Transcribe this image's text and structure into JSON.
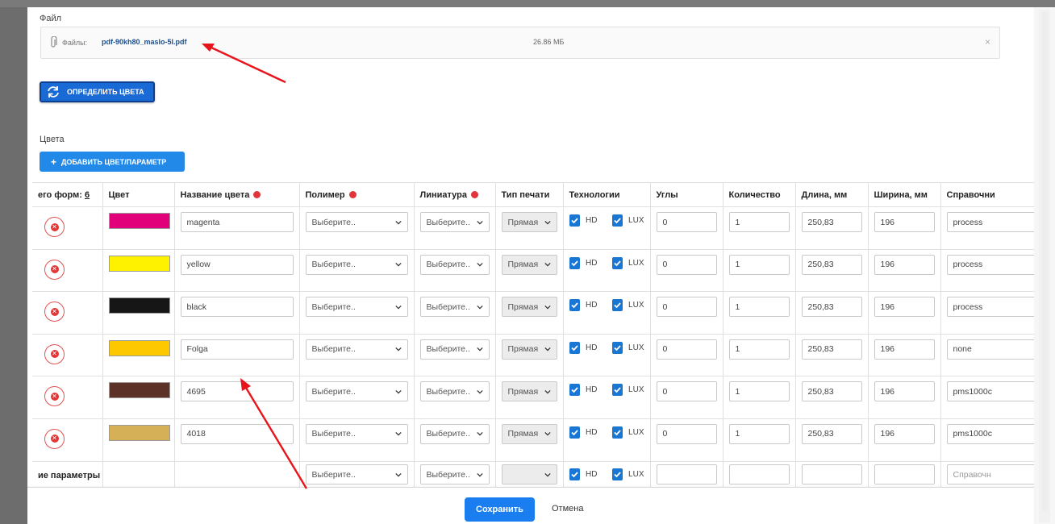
{
  "file_section": {
    "label": "Файл",
    "files_label": "Файлы:",
    "file_name": "pdf-90kh80_maslo-5l.pdf",
    "file_size": "26.86 МБ",
    "remove": "×"
  },
  "detect_button": {
    "label": "ОПРЕДЕЛИТЬ ЦВЕТА"
  },
  "colors_section": {
    "label": "Цвета",
    "add_button": "ДОБАВИТЬ ЦВЕТ/ПАРАМЕТР",
    "plus": "+"
  },
  "table": {
    "headers": {
      "forms_prefix": "его форм: ",
      "forms_count": "6",
      "color": "Цвет",
      "color_name": "Название цвета",
      "polymer": "Полимер",
      "lineature": "Линиатура",
      "print_type": "Тип печати",
      "technologies": "Технологии",
      "angles": "Углы",
      "quantity": "Количество",
      "length": "Длина, мм",
      "width": "Ширина, мм",
      "reference": "Справочни"
    },
    "rows": [
      {
        "swatch": "#e2007a",
        "name": "magenta",
        "polymer": "Выберите..",
        "lineature": "Выберите..",
        "print_type": "Прямая",
        "hd": "HD",
        "lux": "LUX",
        "angle": "0",
        "qty": "1",
        "length": "250,83",
        "width": "196",
        "ref": "process"
      },
      {
        "swatch": "#fff200",
        "name": "yellow",
        "polymer": "Выберите..",
        "lineature": "Выберите..",
        "print_type": "Прямая",
        "hd": "HD",
        "lux": "LUX",
        "angle": "0",
        "qty": "1",
        "length": "250,83",
        "width": "196",
        "ref": "process"
      },
      {
        "swatch": "#161616",
        "name": "black",
        "polymer": "Выберите..",
        "lineature": "Выберите..",
        "print_type": "Прямая",
        "hd": "HD",
        "lux": "LUX",
        "angle": "0",
        "qty": "1",
        "length": "250,83",
        "width": "196",
        "ref": "process"
      },
      {
        "swatch": "#fdc800",
        "name": "Folga",
        "polymer": "Выберите..",
        "lineature": "Выберите..",
        "print_type": "Прямая",
        "hd": "HD",
        "lux": "LUX",
        "angle": "0",
        "qty": "1",
        "length": "250,83",
        "width": "196",
        "ref": "none"
      },
      {
        "swatch": "#5c3128",
        "name": "4695",
        "polymer": "Выберите..",
        "lineature": "Выберите..",
        "print_type": "Прямая",
        "hd": "HD",
        "lux": "LUX",
        "angle": "0",
        "qty": "1",
        "length": "250,83",
        "width": "196",
        "ref": "pms1000c"
      },
      {
        "swatch": "#d6b057",
        "name": "4018",
        "polymer": "Выберите..",
        "lineature": "Выберите..",
        "print_type": "Прямая",
        "hd": "HD",
        "lux": "LUX",
        "angle": "0",
        "qty": "1",
        "length": "250,83",
        "width": "196",
        "ref": "pms1000c"
      }
    ],
    "params_row": {
      "label": "ие параметры",
      "polymer": "Выберите..",
      "lineature": "Выберите..",
      "hd": "HD",
      "lux": "LUX",
      "ref_placeholder": "Справочн"
    }
  },
  "footer": {
    "save": "Сохранить",
    "cancel": "Отмена"
  },
  "colors": {
    "primary": "#1a7ef0",
    "checkbox": "#1976d2",
    "danger": "#e23636",
    "annotation_arrow": "#e8141b"
  }
}
